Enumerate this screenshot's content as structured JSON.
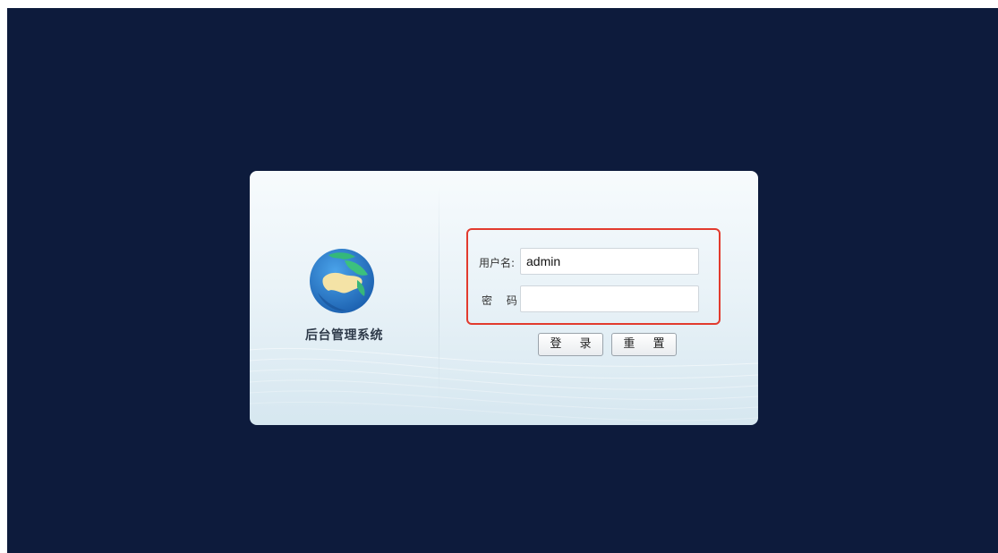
{
  "app": {
    "title": "后台管理系统",
    "logo_icon": "globe-icon"
  },
  "login_form": {
    "username_label": "用户名:",
    "username_value": "admin",
    "password_label": "密 码:",
    "password_value": "",
    "highlight_color": "#e23b2e"
  },
  "actions": {
    "login_label": "登 录",
    "reset_label": "重 置"
  },
  "colors": {
    "background": "#0d1b3c",
    "card_top": "#f7fbfd",
    "card_bottom": "#d6e7f0"
  }
}
